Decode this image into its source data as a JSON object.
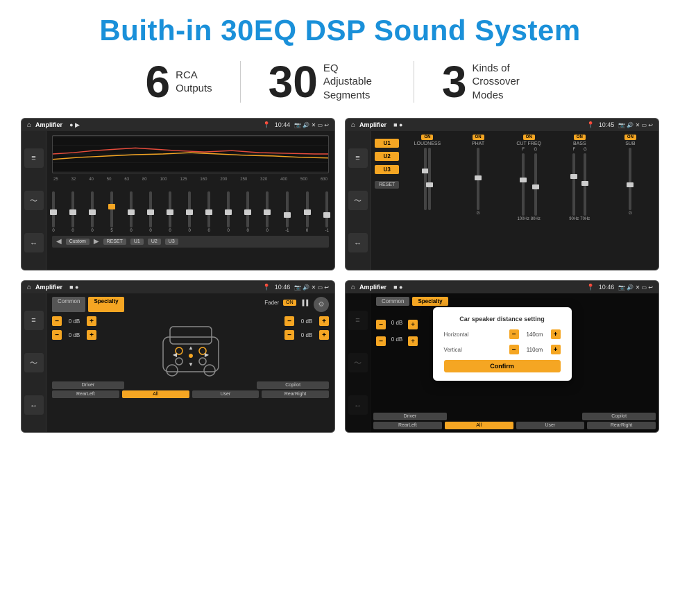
{
  "title": "Buith-in 30EQ DSP Sound System",
  "stats": [
    {
      "number": "6",
      "text": "RCA\nOutputs"
    },
    {
      "number": "30",
      "text": "EQ Adjustable\nSegments"
    },
    {
      "number": "3",
      "text": "Kinds of\nCrossover Modes"
    }
  ],
  "screens": [
    {
      "id": "eq-screen",
      "statusBar": {
        "appName": "Amplifier",
        "time": "10:44"
      }
    },
    {
      "id": "crossover-screen",
      "statusBar": {
        "appName": "Amplifier",
        "time": "10:45"
      }
    },
    {
      "id": "speaker-screen",
      "statusBar": {
        "appName": "Amplifier",
        "time": "10:46"
      },
      "tabs": [
        "Common",
        "Specialty"
      ],
      "faderLabel": "Fader",
      "dbValues": [
        "0 dB",
        "0 dB",
        "0 dB",
        "0 dB"
      ],
      "positions": [
        "Driver",
        "RearLeft",
        "Copilot",
        "RearRight",
        "All",
        "User"
      ]
    },
    {
      "id": "speaker-dialog-screen",
      "statusBar": {
        "appName": "Amplifier",
        "time": "10:46"
      },
      "dialog": {
        "title": "Car speaker distance setting",
        "horizontal": {
          "label": "Horizontal",
          "value": "140cm"
        },
        "vertical": {
          "label": "Vertical",
          "value": "110cm"
        },
        "confirmLabel": "Confirm"
      },
      "dbValues": [
        "0 dB",
        "0 dB"
      ],
      "positions": [
        "Driver",
        "RearLeft",
        "Copilot",
        "RearRight"
      ]
    }
  ],
  "eqBands": [
    "25",
    "32",
    "40",
    "50",
    "63",
    "80",
    "100",
    "125",
    "160",
    "200",
    "250",
    "320",
    "400",
    "500",
    "630"
  ],
  "eqValues": [
    "0",
    "0",
    "0",
    "5",
    "0",
    "0",
    "0",
    "0",
    "0",
    "0",
    "0",
    "0",
    "0",
    "-1",
    "0",
    "-1"
  ],
  "uButtons": [
    "U1",
    "U2",
    "U3"
  ],
  "crossoverLabels": [
    "LOUDNESS",
    "PHAT",
    "CUT FREQ",
    "BASS",
    "SUB"
  ],
  "eqBottomButtons": [
    "Custom",
    "RESET",
    "U1",
    "U2",
    "U3"
  ]
}
